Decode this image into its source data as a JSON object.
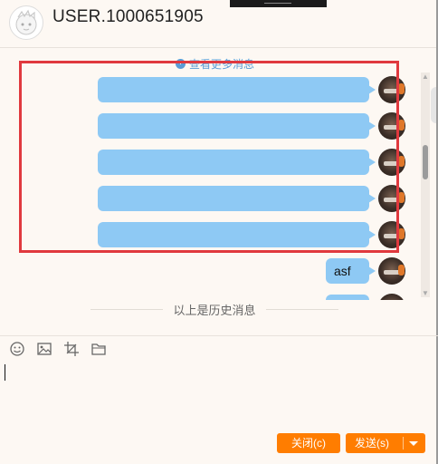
{
  "header": {
    "title": "USER.1000651905"
  },
  "chat": {
    "more_messages": "查看更多消息",
    "messages": [
      {
        "text": ""
      },
      {
        "text": ""
      },
      {
        "text": ""
      },
      {
        "text": ""
      },
      {
        "text": ""
      },
      {
        "text": "asf"
      },
      {
        "text": ""
      }
    ],
    "history_label": "以上是历史消息"
  },
  "footer": {
    "close_label": "关闭(c)",
    "send_label": "发送(s)"
  },
  "colors": {
    "accent": "#ff7d00",
    "bubble": "#8ec9f4",
    "link": "#5a9bd5",
    "highlight": "#e0393e"
  }
}
